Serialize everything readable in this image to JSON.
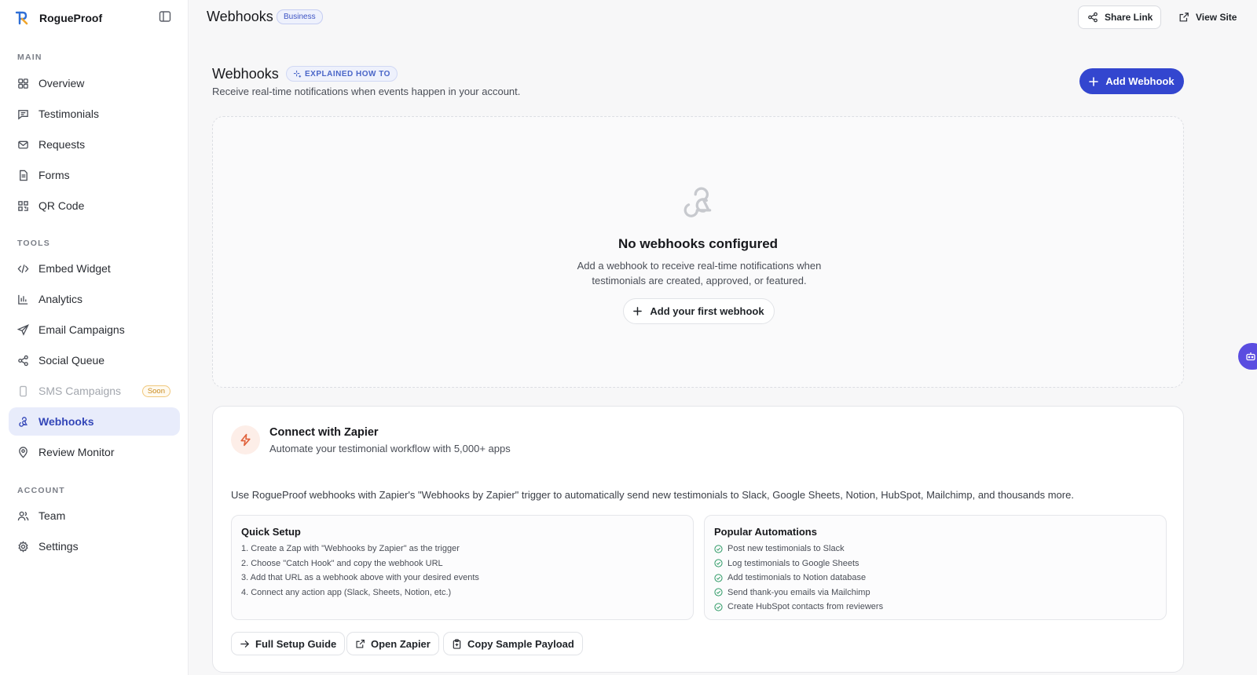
{
  "app": {
    "name": "RogueProof",
    "colors": {
      "accent": "#3346cf",
      "active_bg": "#e8ecfb",
      "zapier": "#e0603a",
      "check": "#2e9a66",
      "assistant": "#5a4de0"
    }
  },
  "sidebar": {
    "sections": [
      {
        "label": "MAIN"
      },
      {
        "label": "TOOLS"
      },
      {
        "label": "ACCOUNT"
      }
    ],
    "items": [
      {
        "label": "Overview",
        "icon": "grid-icon"
      },
      {
        "label": "Testimonials",
        "icon": "message-square-icon"
      },
      {
        "label": "Requests",
        "icon": "mail-icon"
      },
      {
        "label": "Forms",
        "icon": "file-text-icon"
      },
      {
        "label": "QR Code",
        "icon": "qr-code-icon"
      },
      {
        "label": "Embed Widget",
        "icon": "code-icon"
      },
      {
        "label": "Analytics",
        "icon": "bar-chart-icon"
      },
      {
        "label": "Email Campaigns",
        "icon": "send-icon"
      },
      {
        "label": "Social Queue",
        "icon": "share-icon"
      },
      {
        "label": "SMS Campaigns",
        "icon": "smartphone-icon",
        "badge": "Soon",
        "disabled": true
      },
      {
        "label": "Webhooks",
        "icon": "webhook-icon",
        "active": true
      },
      {
        "label": "Review Monitor",
        "icon": "map-pin-icon"
      },
      {
        "label": "Team",
        "icon": "users-icon"
      },
      {
        "label": "Settings",
        "icon": "gear-icon"
      }
    ]
  },
  "topbar": {
    "title": "Webhooks",
    "plan_badge": "Business",
    "share_label": "Share Link",
    "view_label": "View Site"
  },
  "page": {
    "title": "Webhooks",
    "how_badge": "EXPLAINED HOW TO",
    "subtitle": "Receive real-time notifications when events happen in your account.",
    "add_button": "Add Webhook"
  },
  "empty_state": {
    "title": "No webhooks configured",
    "text": "Add a webhook to receive real-time notifications when testimonials are created, approved, or featured.",
    "button": "Add your first webhook"
  },
  "zapier": {
    "title": "Connect with Zapier",
    "subtitle": "Automate your testimonial workflow with 5,000+ apps",
    "description": "Use RogueProof webhooks with Zapier's \"Webhooks by Zapier\" trigger to automatically send new testimonials to Slack, Google Sheets, Notion, HubSpot, Mailchimp, and thousands more.",
    "quick_setup": {
      "title": "Quick Setup",
      "steps": [
        "1. Create a Zap with \"Webhooks by Zapier\" as the trigger",
        "2. Choose \"Catch Hook\" and copy the webhook URL",
        "3. Add that URL as a webhook above with your desired events",
        "4. Connect any action app (Slack, Sheets, Notion, etc.)"
      ]
    },
    "popular": {
      "title": "Popular Automations",
      "items": [
        "Post new testimonials to Slack",
        "Log testimonials to Google Sheets",
        "Add testimonials to Notion database",
        "Send thank-you emails via Mailchimp",
        "Create HubSpot contacts from reviewers"
      ]
    },
    "actions": {
      "guide": "Full Setup Guide",
      "open": "Open Zapier",
      "copy": "Copy Sample Payload"
    }
  }
}
